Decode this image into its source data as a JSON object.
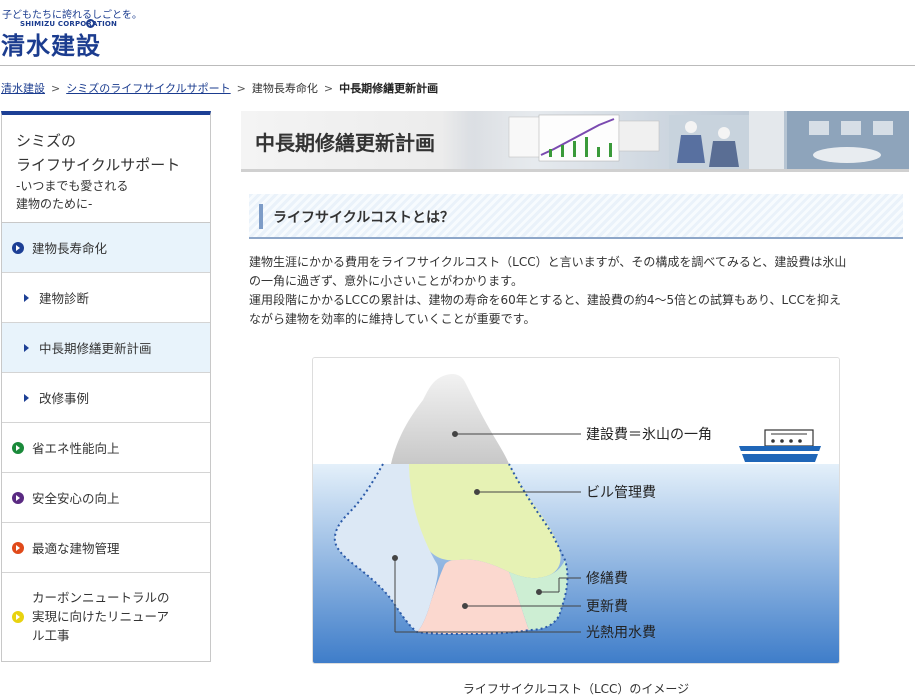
{
  "header": {
    "tagline": "子どもたちに誇れるしごとを。",
    "corp_en": "SHIMIZU CORPORATION",
    "company_name": "清水建設"
  },
  "breadcrumb": {
    "items": [
      "清水建設",
      "シミズのライフサイクルサポート",
      "建物長寿命化",
      "中長期修繕更新計画"
    ],
    "separator": ">"
  },
  "sidebar": {
    "title_line1": "シミズの",
    "title_line2": "ライフサイクルサポート",
    "subtitle_line1": "-いつまでも愛される",
    "subtitle_line2": "建物のために-",
    "items": [
      {
        "label": "建物長寿命化",
        "dot_color": "#1c3f95"
      },
      {
        "label": "建物診断"
      },
      {
        "label": "中長期修繕更新計画"
      },
      {
        "label": "改修事例"
      },
      {
        "label": "省エネ性能向上",
        "dot_color": "#1a8a3a"
      },
      {
        "label": "安全安心の向上",
        "dot_color": "#5a2a82"
      },
      {
        "label": "最適な建物管理",
        "dot_color": "#e04a1a"
      },
      {
        "label": "カーボンニュートラルの実現に向けたリニューアル工事",
        "line1": "カーボンニュートラルの",
        "line2": "実現に向けたリニューア",
        "line3": "ル工事",
        "dot_color": "#e8d210"
      }
    ]
  },
  "main": {
    "banner_title": "中長期修繕更新計画",
    "section_title": "ライフサイクルコストとは？",
    "paragraph1_line1": "建物生涯にかかる費用をライフサイクルコスト（LCC）と言いますが、その構成を調べてみると、建設費は氷山",
    "paragraph1_line2": "の一角に過ぎず、意外に小さいことがわかります。",
    "paragraph2_line1": "運用段階にかかるLCCの累計は、建物の寿命を60年とすると、建設費の約4〜5倍との試算もあり、LCCを抑え",
    "paragraph2_line2": "ながら建物を効率的に維持していくことが重要です。"
  },
  "figure": {
    "labels": {
      "construction": "建設費＝氷山の一角",
      "building_mgmt": "ビル管理費",
      "repair": "修繕費",
      "renewal": "更新費",
      "utilities": "光熱用水費"
    },
    "caption": "ライフサイクルコスト（LCC）のイメージ",
    "colors": {
      "sea_top": "#e4f0fa",
      "sea_bottom": "#3d7cc9",
      "peak": "#d6d6d6",
      "building_mgmt": "#e6f2b4",
      "utilities_left": "#dce8f5",
      "renewal": "#fbd8cf",
      "repair": "#cdeed3"
    }
  }
}
